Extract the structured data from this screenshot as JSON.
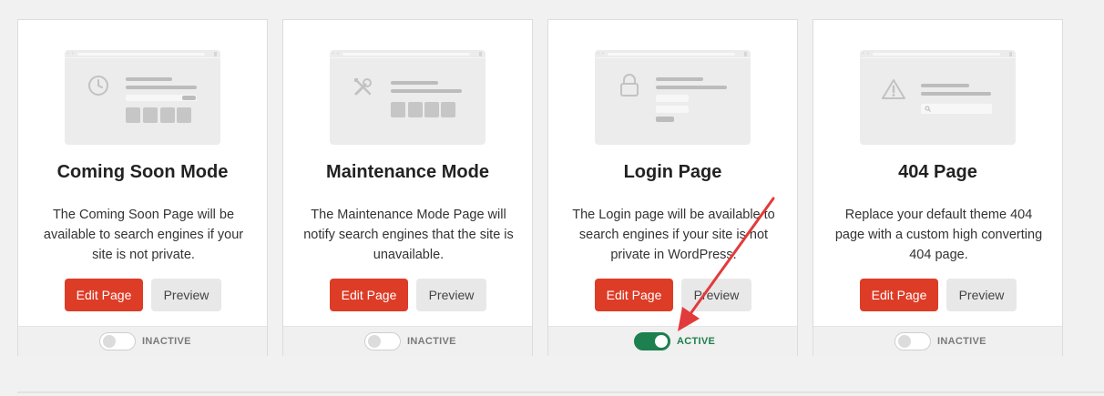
{
  "cards": [
    {
      "title": "Coming Soon Mode",
      "description": "The Coming Soon Page will be available to search engines if your site is not private.",
      "icon": "clock-icon",
      "edit_label": "Edit Page",
      "preview_label": "Preview",
      "active": false,
      "status_label": "INACTIVE"
    },
    {
      "title": "Maintenance Mode",
      "description": "The Maintenance Mode Page will notify search engines that the site is unavailable.",
      "icon": "tools-icon",
      "edit_label": "Edit Page",
      "preview_label": "Preview",
      "active": false,
      "status_label": "INACTIVE"
    },
    {
      "title": "Login Page",
      "description": "The Login page will be available to search engines if your site is not private in WordPress.",
      "icon": "lock-icon",
      "edit_label": "Edit Page",
      "preview_label": "Preview",
      "active": true,
      "status_label": "ACTIVE"
    },
    {
      "title": "404 Page",
      "description": "Replace your default theme 404 page with a custom high converting 404 page.",
      "icon": "warning-icon",
      "edit_label": "Edit Page",
      "preview_label": "Preview",
      "active": false,
      "status_label": "INACTIVE"
    }
  ],
  "colors": {
    "accent": "#dd3c27",
    "active_green": "#1e7f4f",
    "annotation_arrow": "#e23b3b"
  },
  "annotation": {
    "icon": "red-arrow-icon",
    "points_to": "Login Page toggle"
  }
}
